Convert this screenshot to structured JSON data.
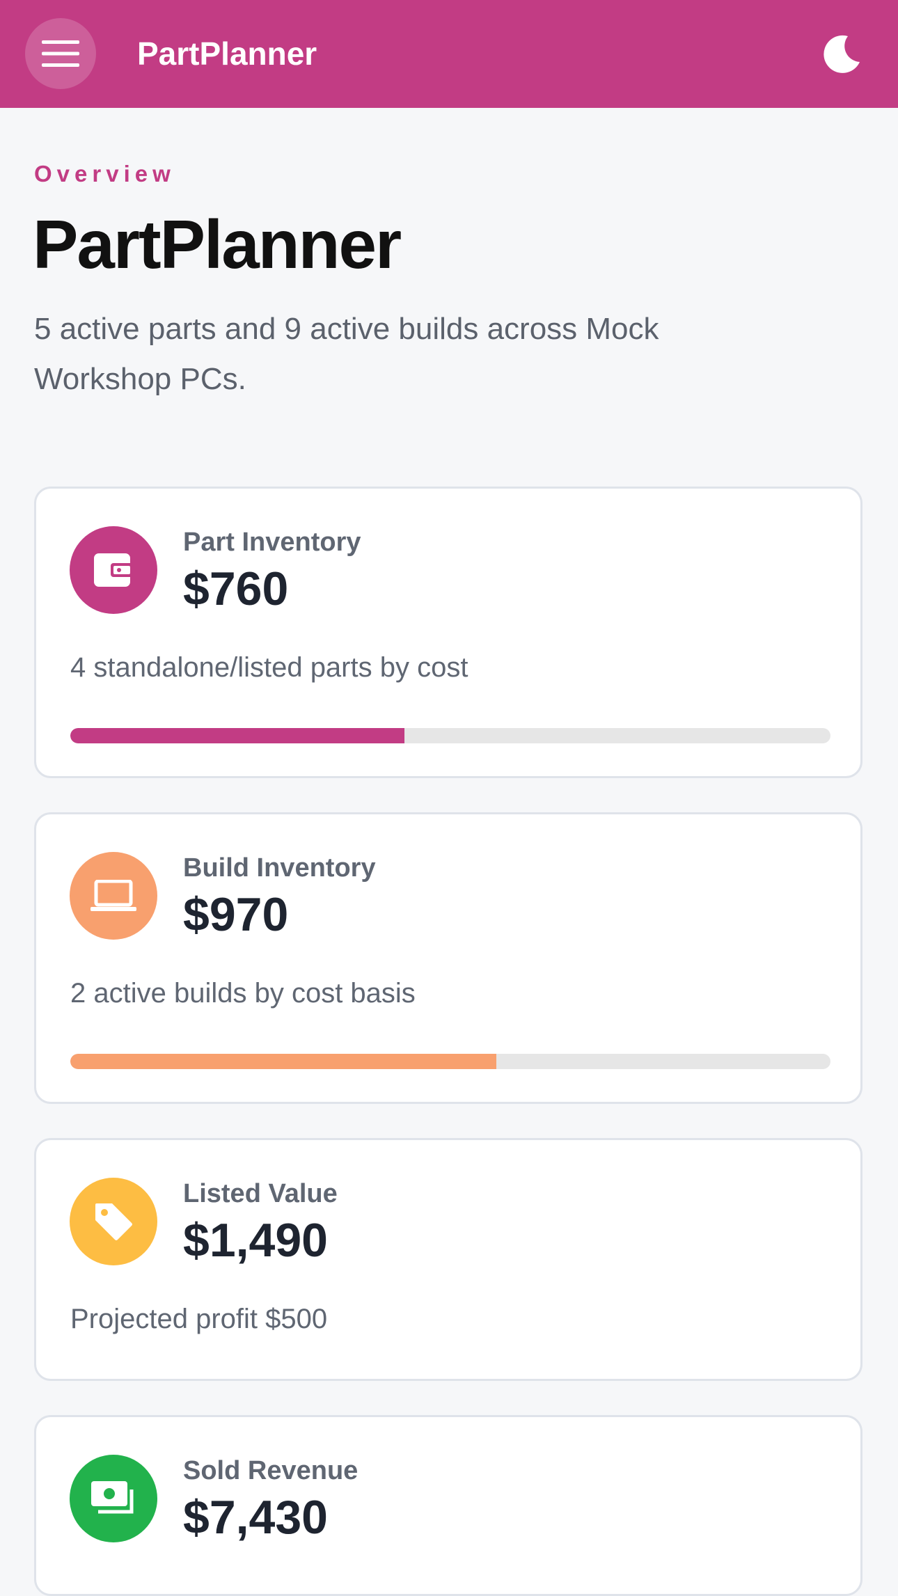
{
  "appbar": {
    "title": "PartPlanner",
    "color": "#c23c84",
    "menu_icon": "hamburger-menu-icon",
    "theme_icon": "moon-icon"
  },
  "header": {
    "eyebrow": "Overview",
    "title": "PartPlanner",
    "subtitle": "5 active parts and 9 active builds across Mock Workshop PCs."
  },
  "cards": [
    {
      "label": "Part Inventory",
      "value": "$760",
      "description": "4 standalone/listed parts by cost",
      "icon": "wallet-icon",
      "color": "#c23c84",
      "progress": 0.44
    },
    {
      "label": "Build Inventory",
      "value": "$970",
      "description": "2 active builds by cost basis",
      "icon": "laptop-icon",
      "color": "#f8a06e",
      "progress": 0.56
    },
    {
      "label": "Listed Value",
      "value": "$1,490",
      "description": "Projected profit $500",
      "icon": "tag-icon",
      "color": "#fdbd43"
    },
    {
      "label": "Sold Revenue",
      "value": "$7,430",
      "icon": "money-icon",
      "color": "#22b24c"
    }
  ]
}
